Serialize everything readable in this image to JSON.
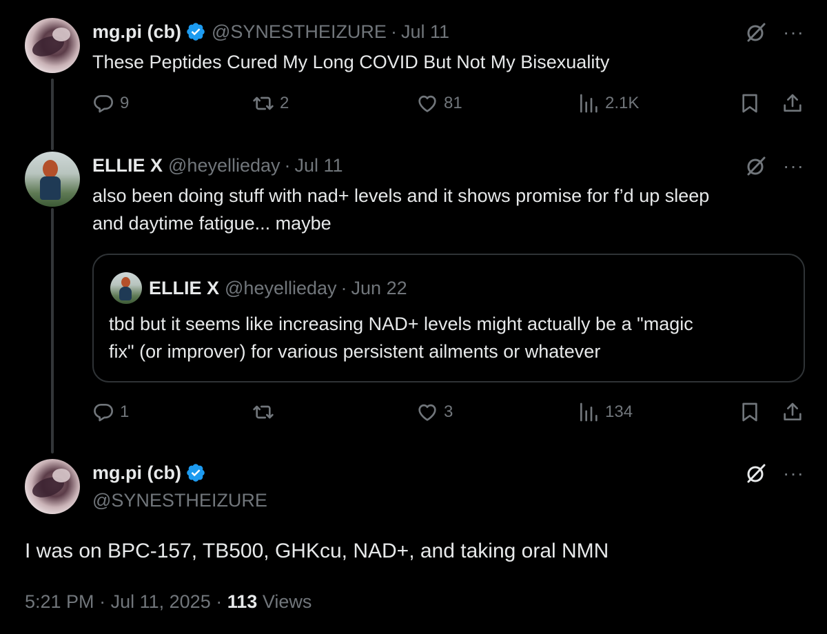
{
  "colors": {
    "background": "#000000",
    "text": "#e7e9ea",
    "muted": "#71767b",
    "verified": "#1d9bf0",
    "border": "#2f3336"
  },
  "tweet1": {
    "name": "mg.pi (cb)",
    "verified": true,
    "handle": "@SYNESTHEIZURE",
    "date": "Jul 11",
    "text": "These Peptides Cured My Long COVID But Not My Bisexuality",
    "replies": "9",
    "reposts": "2",
    "likes": "81",
    "views": "2.1K"
  },
  "tweet2": {
    "name": "ELLIE X",
    "handle": "@heyellieday",
    "date": "Jul 11",
    "text_line1": "also been doing stuff with nad+ levels and it shows promise for f’d up sleep",
    "text_line2": "and daytime fatigue... maybe",
    "quote": {
      "name": "ELLIE X",
      "handle": "@heyellieday",
      "date": "Jun 22",
      "text_line1": "tbd but it seems like increasing NAD+ levels might actually be a \"magic",
      "text_line2": "fix\" (or improver) for various persistent ailments or whatever"
    },
    "replies": "1",
    "reposts": "",
    "likes": "3",
    "views": "134"
  },
  "main_tweet": {
    "name": "mg.pi (cb)",
    "verified": true,
    "handle": "@SYNESTHEIZURE",
    "text": "I was on BPC-157, TB500, GHKcu, NAD+, and taking oral NMN",
    "time": "5:21 PM",
    "date": "Jul 11, 2025",
    "views_count": "113",
    "views_label": "Views"
  },
  "separator": "·",
  "more_label": "···",
  "icons": [
    "reply-icon",
    "repost-icon",
    "like-icon",
    "views-icon",
    "bookmark-icon",
    "share-icon",
    "grok-icon",
    "more-icon",
    "verified-icon"
  ]
}
